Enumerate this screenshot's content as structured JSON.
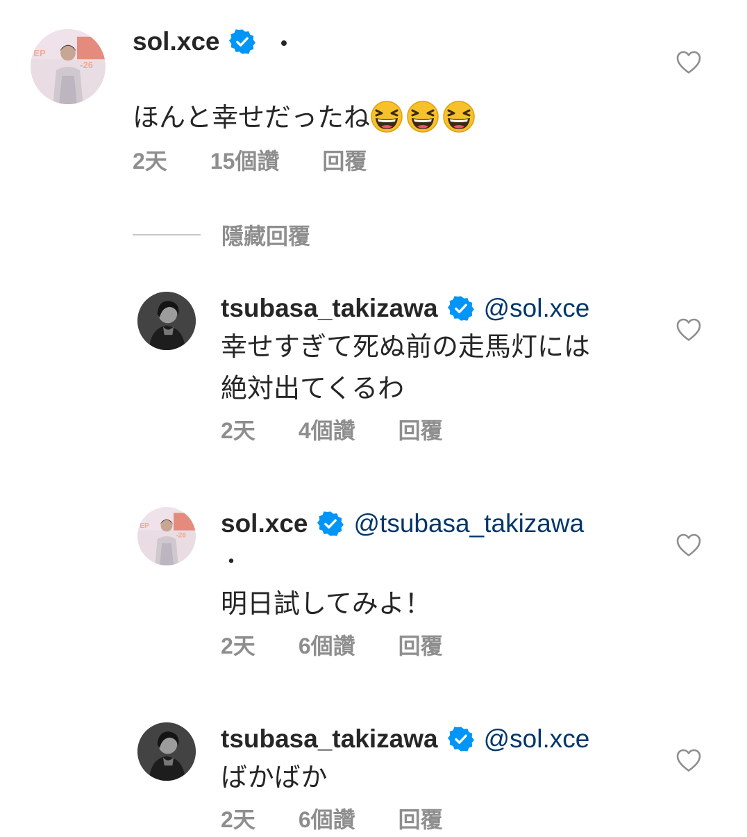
{
  "comments": [
    {
      "username": "sol.xce",
      "verified": true,
      "mention": "",
      "separator_dot": "・",
      "text_lines": [
        "ほんと幸せだったね"
      ],
      "emoji": [
        "grinning-squinting-face",
        "grinning-squinting-face",
        "grinning-squinting-face"
      ],
      "time": "2天",
      "likes": "15個讚",
      "reply": "回覆",
      "avatar": "sol-xce-avatar"
    },
    {
      "username": "tsubasa_takizawa",
      "verified": true,
      "mention": "@sol.xce",
      "text_lines": [
        "幸せすぎて死ぬ前の走馬灯には",
        "絶対出てくるわ"
      ],
      "time": "2天",
      "likes": "4個讚",
      "reply": "回覆",
      "avatar": "tsubasa-avatar"
    },
    {
      "username": "sol.xce",
      "verified": true,
      "mention": "@tsubasa_takizawa",
      "separator_dot": "・",
      "text_lines": [
        "明日試してみよ！"
      ],
      "time": "2天",
      "likes": "6個讚",
      "reply": "回覆",
      "avatar": "sol-xce-avatar"
    },
    {
      "username": "tsubasa_takizawa",
      "verified": true,
      "mention": "@sol.xce",
      "text_lines": [
        "ばかばか"
      ],
      "time": "2天",
      "likes": "6個讚",
      "reply": "回覆",
      "avatar": "tsubasa-avatar"
    }
  ],
  "hide_replies_label": "隱藏回覆",
  "colors": {
    "verified": "#0095f6",
    "mention": "#00376b",
    "meta": "#8e8e8e",
    "text": "#262626"
  }
}
